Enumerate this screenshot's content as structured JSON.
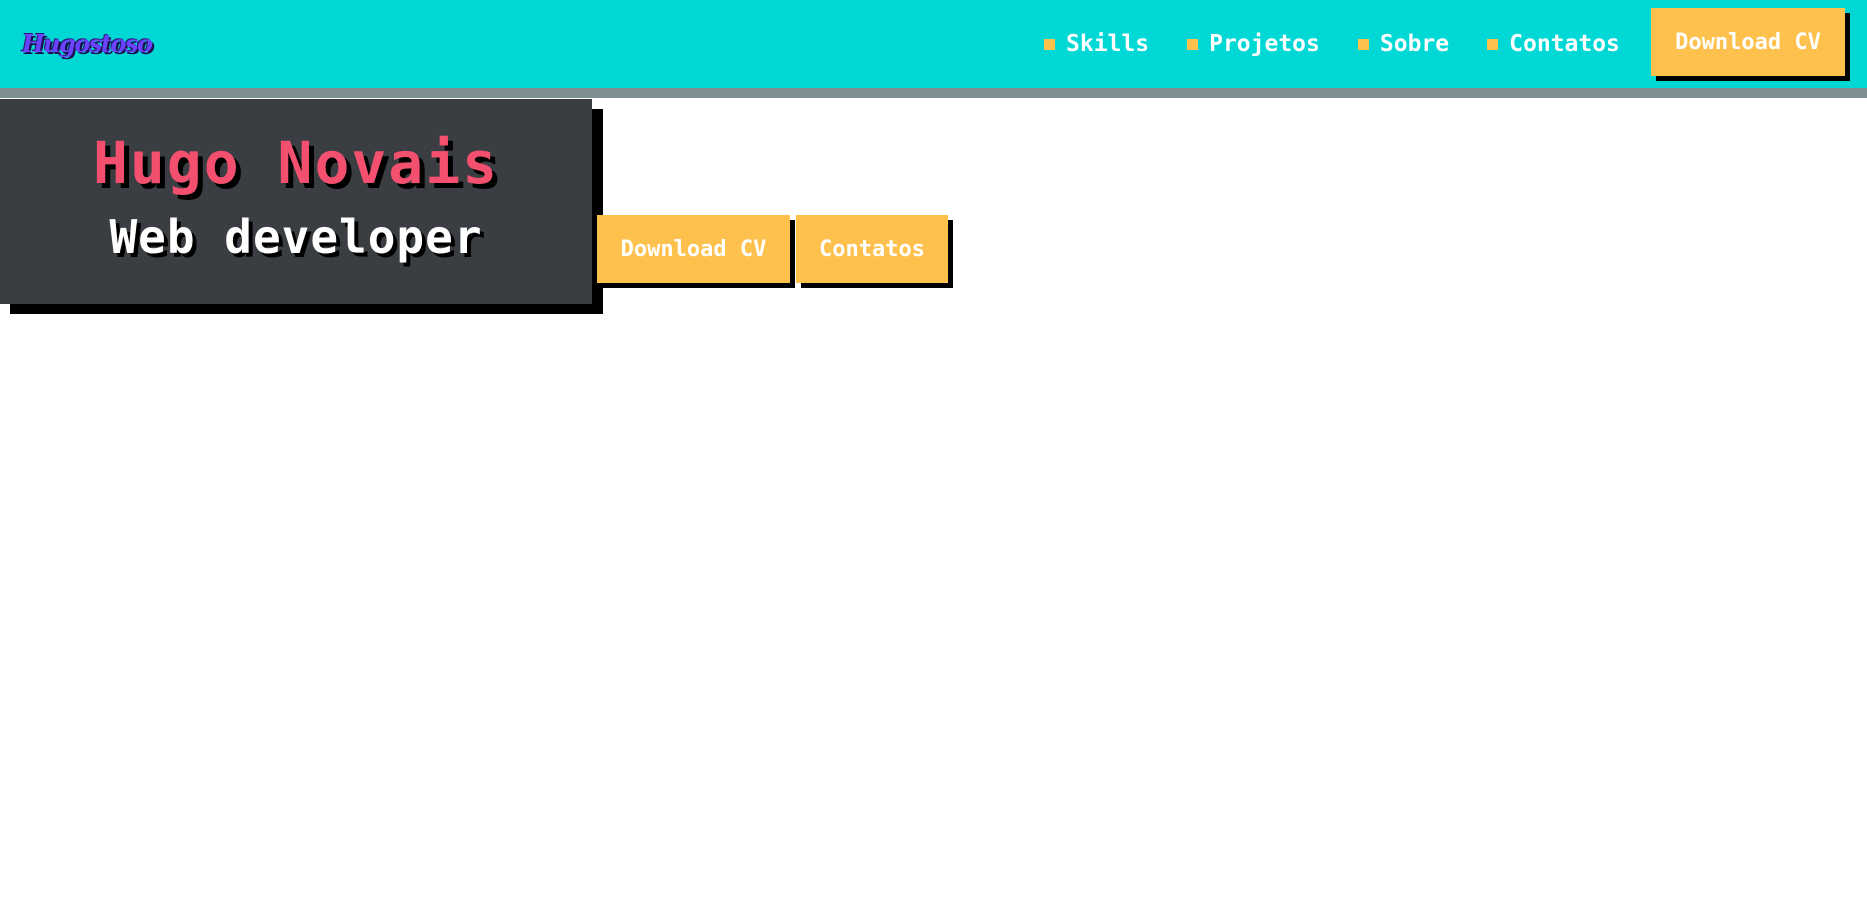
{
  "header": {
    "logo_text": "Hugostoso",
    "nav": [
      {
        "label": "Skills"
      },
      {
        "label": "Projetos"
      },
      {
        "label": "Sobre"
      },
      {
        "label": "Contatos"
      }
    ],
    "download_label": "Download CV"
  },
  "hero": {
    "name": "Hugo Novais",
    "role": "Web developer",
    "download_label": "Download CV",
    "contact_label": "Contatos"
  },
  "colors": {
    "topbar": "#00d8d6",
    "topbar_underline": "#7d8f93",
    "accent": "#ffc14d",
    "hero_bg": "#3a3e42",
    "hero_name": "#f2506e",
    "logo": "#6a43ff"
  }
}
